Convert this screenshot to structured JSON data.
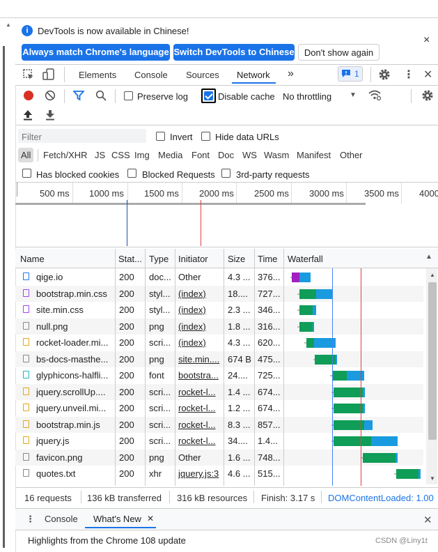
{
  "infobar": {
    "message": "DevTools is now available in Chinese!",
    "btn_match": "Always match Chrome's language",
    "btn_switch": "Switch DevTools to Chinese",
    "btn_dont_show": "Don't show again",
    "close": "×",
    "info_glyph": "i"
  },
  "tabs": {
    "elements": "Elements",
    "console": "Console",
    "sources": "Sources",
    "network": "Network",
    "more": "»",
    "issues_count": "1"
  },
  "toolbar": {
    "preserve_log": "Preserve log",
    "disable_cache": "Disable cache",
    "throttling": "No throttling",
    "throttling_arrow": "▼"
  },
  "filter": {
    "placeholder": "Filter",
    "invert": "Invert",
    "hide_data_urls": "Hide data URLs",
    "types": [
      "All",
      "Fetch/XHR",
      "JS",
      "CSS",
      "Img",
      "Media",
      "Font",
      "Doc",
      "WS",
      "Wasm",
      "Manifest",
      "Other"
    ],
    "blocked_cookies": "Has blocked cookies",
    "blocked_requests": "Blocked Requests",
    "third_party": "3rd-party requests"
  },
  "overview": {
    "ticks": [
      "500 ms",
      "1000 ms",
      "1500 ms",
      "2000 ms",
      "2500 ms",
      "3000 ms",
      "3500 ms",
      "4000"
    ]
  },
  "table": {
    "headers": {
      "name": "Name",
      "status": "Stat...",
      "type": "Type",
      "initiator": "Initiator",
      "size": "Size",
      "time": "Time",
      "waterfall": "Waterfall",
      "sort": "▲"
    },
    "rows": [
      {
        "name": "qige.io",
        "status": "200",
        "type": "doc...",
        "initiator": "Other",
        "size": "4.3 ...",
        "time": "376...",
        "icon": "document-icon"
      },
      {
        "name": "bootstrap.min.css",
        "status": "200",
        "type": "styl...",
        "initiator": "(index)",
        "size": "18....",
        "time": "727...",
        "icon": "stylesheet-icon"
      },
      {
        "name": "site.min.css",
        "status": "200",
        "type": "styl...",
        "initiator": "(index)",
        "size": "2.3 ...",
        "time": "346...",
        "icon": "stylesheet-icon"
      },
      {
        "name": "null.png",
        "status": "200",
        "type": "png",
        "initiator": "(index)",
        "size": "1.8 ...",
        "time": "316...",
        "icon": "image-icon"
      },
      {
        "name": "rocket-loader.mi...",
        "status": "200",
        "type": "scri...",
        "initiator": "(index)",
        "size": "4.3 ...",
        "time": "620...",
        "icon": "script-icon"
      },
      {
        "name": "bs-docs-masthe...",
        "status": "200",
        "type": "png",
        "initiator": "site.min....",
        "size": "674 B",
        "time": "475...",
        "icon": "image-icon"
      },
      {
        "name": "glyphicons-halfli...",
        "status": "200",
        "type": "font",
        "initiator": "bootstra...",
        "size": "24....",
        "time": "725...",
        "icon": "font-icon"
      },
      {
        "name": "jquery.scrollUp....",
        "status": "200",
        "type": "scri...",
        "initiator": "rocket-l...",
        "size": "1.4 ...",
        "time": "674...",
        "icon": "script-icon"
      },
      {
        "name": "jquery.unveil.mi...",
        "status": "200",
        "type": "scri...",
        "initiator": "rocket-l...",
        "size": "1.2 ...",
        "time": "674...",
        "icon": "script-icon"
      },
      {
        "name": "bootstrap.min.js",
        "status": "200",
        "type": "scri...",
        "initiator": "rocket-l...",
        "size": "8.3 ...",
        "time": "857...",
        "icon": "script-icon"
      },
      {
        "name": "jquery.js",
        "status": "200",
        "type": "scri...",
        "initiator": "rocket-l...",
        "size": "34....",
        "time": "1.4...",
        "icon": "script-icon"
      },
      {
        "name": "favicon.png",
        "status": "200",
        "type": "png",
        "initiator": "Other",
        "size": "1.6 ...",
        "time": "748...",
        "icon": "file-icon"
      },
      {
        "name": "quotes.txt",
        "status": "200",
        "type": "xhr",
        "initiator": "jquery.js:3",
        "size": "4.6 ...",
        "time": "515...",
        "icon": "file-icon"
      }
    ]
  },
  "status_bar": {
    "requests": "16 requests",
    "transferred": "136 kB transferred",
    "resources": "316 kB resources",
    "finish": "Finish: 3.17 s",
    "dom_loaded": "DOMContentLoaded: 1.00"
  },
  "drawer": {
    "console": "Console",
    "whats_new": "What's New",
    "whats_new_close": "✕",
    "close": "✕",
    "menu": "⋮"
  },
  "highlights": "Highlights from the Chrome 108 update",
  "watermark": "CSDN @Liny1t",
  "colors": {
    "accent": "#1a73e8",
    "record": "#d93025",
    "waiting": "#0f9d58",
    "download": "#1a9be0",
    "dom_line": "#4285f4",
    "load_line": "#e04040"
  }
}
